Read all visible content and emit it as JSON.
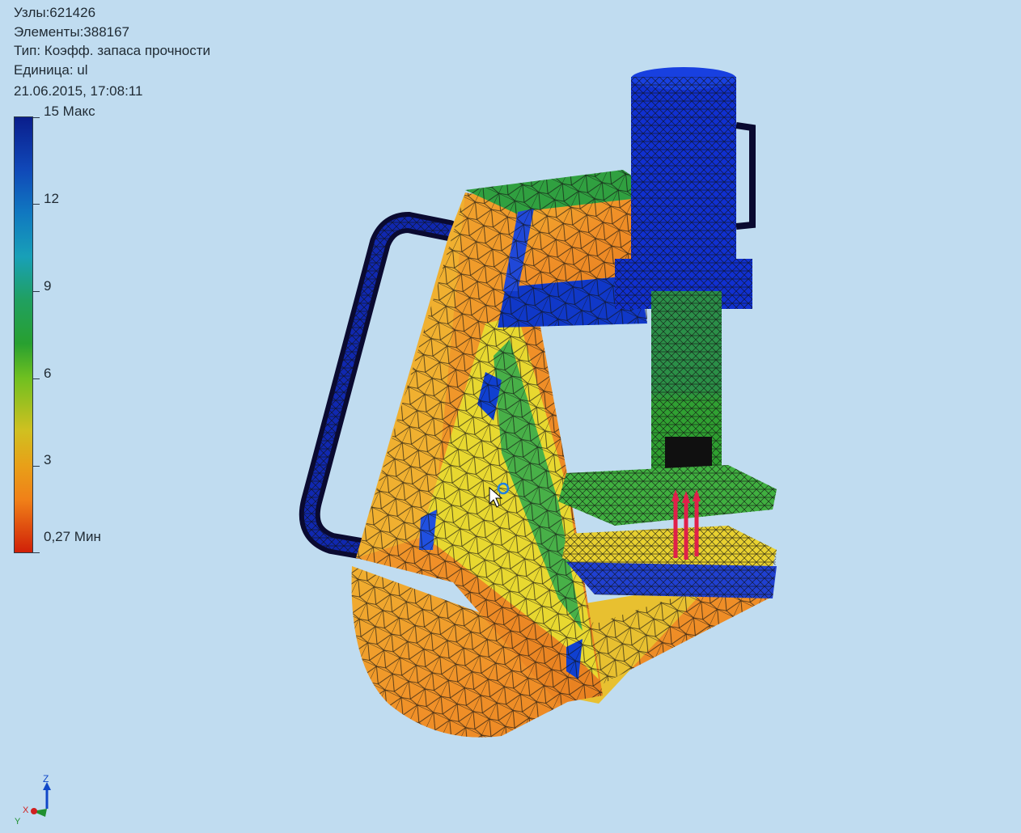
{
  "result_info": {
    "nodes": "Узлы:621426",
    "elements": "Элементы:388167",
    "type": "Тип: Коэфф. запаса прочности",
    "unit": "Единица: ul",
    "datetime": "21.06.2015, 17:08:11"
  },
  "legend": {
    "max_label": "15 Макс",
    "min_label": "0,27 Мин",
    "ticks": [
      "12",
      "9",
      "6",
      "3"
    ],
    "max_value": 15,
    "min_value": 0.27,
    "colors": [
      "#0a1e8c",
      "#1060c8",
      "#18a0b8",
      "#20a050",
      "#60c020",
      "#d8c020",
      "#f08018",
      "#d81808"
    ]
  },
  "triad": {
    "z": "Z",
    "x": "X",
    "y": "Y"
  },
  "colors": {
    "background": "#c0dcf0",
    "mesh_blue": "#1030d0",
    "mesh_orange": "#f0a030",
    "mesh_green": "#40b040",
    "mesh_yellow": "#e8e030",
    "load_arrow": "#e0204a"
  }
}
